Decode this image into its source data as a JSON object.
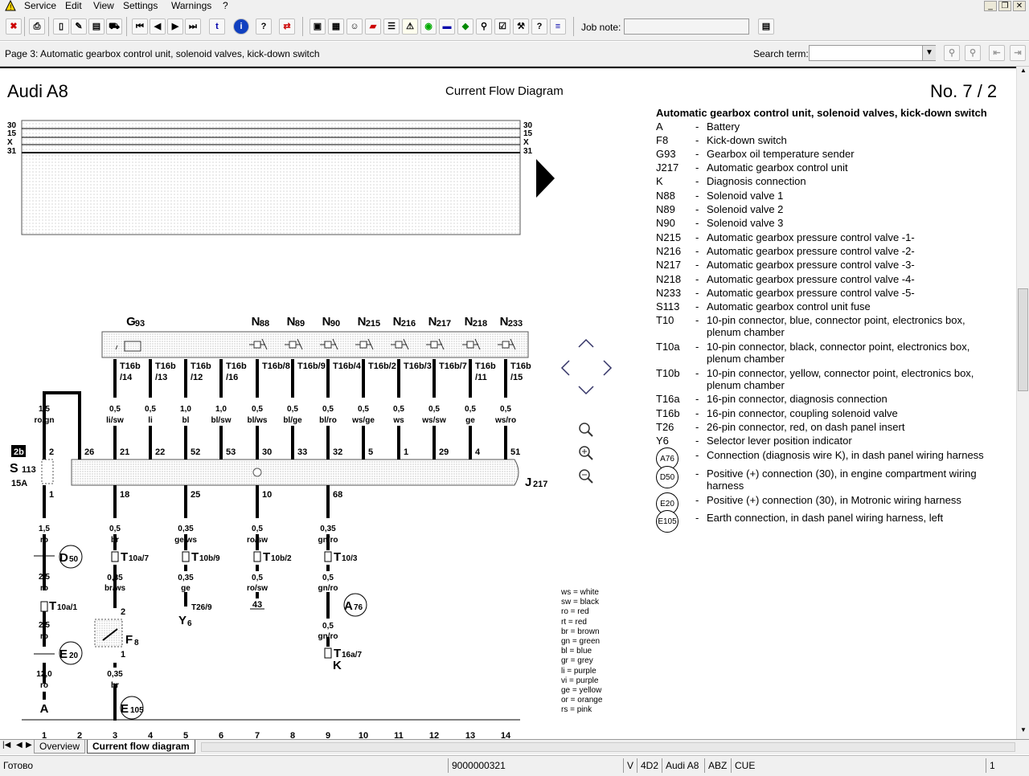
{
  "menu": [
    "Service",
    "Edit",
    "View",
    "Settings",
    "Warnings",
    "?"
  ],
  "toolbar": {
    "job_note_label": "Job note:",
    "job_note_value": ""
  },
  "infobar": {
    "page_title": "Page 3: Automatic gearbox control unit, solenoid valves, kick-down switch",
    "search_label": "Search term:",
    "search_value": ""
  },
  "header": {
    "vehicle": "Audi A8",
    "title": "Current Flow Diagram",
    "number": "No.  7 / 2"
  },
  "bus_labels": [
    "30",
    "15",
    "X",
    "31"
  ],
  "legend": {
    "heading": "Automatic gearbox control unit, solenoid valves, kick-down switch",
    "items": [
      {
        "code": "A",
        "desc": "Battery"
      },
      {
        "code": "F8",
        "desc": "Kick-down switch"
      },
      {
        "code": "G93",
        "desc": "Gearbox oil temperature sender"
      },
      {
        "code": "J217",
        "desc": "Automatic gearbox control unit"
      },
      {
        "code": "K",
        "desc": "Diagnosis connection"
      },
      {
        "code": "N88",
        "desc": "Solenoid valve 1"
      },
      {
        "code": "N89",
        "desc": "Solenoid valve 2"
      },
      {
        "code": "N90",
        "desc": "Solenoid valve 3"
      },
      {
        "code": "N215",
        "desc": "Automatic gearbox pressure control valve -1-"
      },
      {
        "code": "N216",
        "desc": "Automatic gearbox pressure control valve -2-"
      },
      {
        "code": "N217",
        "desc": "Automatic gearbox pressure control valve -3-"
      },
      {
        "code": "N218",
        "desc": "Automatic gearbox pressure control valve -4-"
      },
      {
        "code": "N233",
        "desc": "Automatic gearbox pressure control valve -5-"
      },
      {
        "code": "S113",
        "desc": "Automatic gearbox control unit fuse"
      },
      {
        "code": "T10",
        "desc": "10-pin connector, blue, connector point, electronics box, plenum chamber"
      },
      {
        "code": "T10a",
        "desc": "10-pin connector, black, connector point, electronics box, plenum chamber"
      },
      {
        "code": "T10b",
        "desc": "10-pin connector, yellow, connector point, electronics box, plenum chamber"
      },
      {
        "code": "T16a",
        "desc": "16-pin connector, diagnosis connection"
      },
      {
        "code": "T16b",
        "desc": "16-pin connector, coupling solenoid valve"
      },
      {
        "code": "T26",
        "desc": "26-pin connector, red, on dash panel insert"
      },
      {
        "code": "Y6",
        "desc": "Selector lever position indicator"
      }
    ],
    "circle_items": [
      {
        "code": "A76",
        "desc": "Connection (diagnosis wire K), in dash panel wiring harness"
      },
      {
        "code": "D50",
        "desc": "Positive (+) connection (30), in engine compartment wiring harness"
      },
      {
        "code": "E20",
        "desc": "Positive (+) connection (30), in Motronic wiring harness"
      },
      {
        "code": "E105",
        "desc": "Earth connection, in dash panel wiring harness, left"
      }
    ]
  },
  "wire_colors": [
    "ws  = white",
    "sw  = black",
    "ro  = red",
    "rt   = red",
    "br  = brown",
    "gn  = green",
    "bl   = blue",
    "gr  = grey",
    "li    = purple",
    "vi   = purple",
    "ge  = yellow",
    "or   = orange",
    "rs   = pink"
  ],
  "tracks": [
    "1",
    "2",
    "3",
    "4",
    "5",
    "6",
    "7",
    "8",
    "9",
    "10",
    "11",
    "12",
    "13",
    "14"
  ],
  "components_top": [
    {
      "name": "G",
      "sub": "93"
    },
    {
      "name": "N",
      "sub": "88"
    },
    {
      "name": "N",
      "sub": "89"
    },
    {
      "name": "N",
      "sub": "90"
    },
    {
      "name": "N",
      "sub": "215"
    },
    {
      "name": "N",
      "sub": "216"
    },
    {
      "name": "N",
      "sub": "217"
    },
    {
      "name": "N",
      "sub": "218"
    },
    {
      "name": "N",
      "sub": "233"
    }
  ],
  "connectors_top": [
    "T16b\n/14",
    "T16b\n/13",
    "T16b\n/12",
    "T16b\n/16",
    "T16b/8",
    "T16b/9",
    "T16b/4",
    "T16b/2",
    "T16b/3",
    "T16b/7",
    "T16b\n/11",
    "T16b\n/15"
  ],
  "wires_top": [
    "1,5\nro/gn",
    "0,5\nli/sw",
    "0,5\nli",
    "1,0\nbl",
    "1,0\nbl/sw",
    "0,5\nbl/ws",
    "0,5\nbl/ge",
    "0,5\nbl/ro",
    "0,5\nws/ge",
    "0,5\nws",
    "0,5\nws/sw",
    "0,5\nge",
    "0,5\nws/ro"
  ],
  "pins_top": [
    "2",
    "26",
    "21",
    "22",
    "52",
    "53",
    "30",
    "33",
    "32",
    "5",
    "1",
    "29",
    "4",
    "51"
  ],
  "pins_bottom": [
    "1",
    "18",
    "25",
    "10",
    "68"
  ],
  "tabs": [
    "Overview",
    "Current flow diagram"
  ],
  "status": {
    "left": "Готово",
    "id": "9000000321",
    "v": "V",
    "code": "4D2",
    "model": "Audi A8",
    "abz": "ABZ",
    "cue": "CUE",
    "page": "1"
  }
}
